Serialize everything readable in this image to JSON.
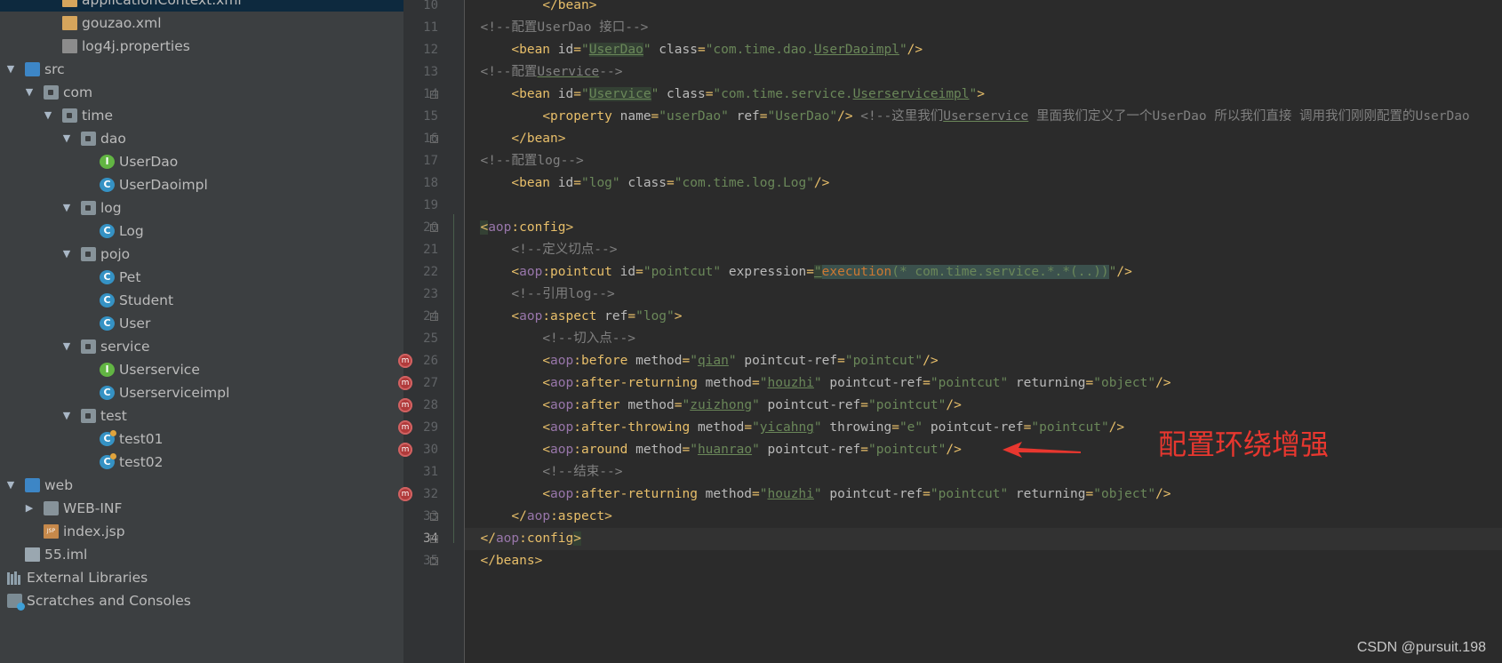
{
  "project_tree": [
    {
      "label": "applicationContext.xml",
      "icon": "xml-file-icon",
      "indent": 2,
      "selected": true
    },
    {
      "label": "gouzao.xml",
      "icon": "xml-file-icon",
      "indent": 2
    },
    {
      "label": "log4j.properties",
      "icon": "properties-file-icon",
      "indent": 2
    },
    {
      "label": "src",
      "icon": "source-folder-icon",
      "indent": 0,
      "expanded": true
    },
    {
      "label": "com",
      "icon": "package-icon",
      "indent": 1,
      "expanded": true
    },
    {
      "label": "time",
      "icon": "package-icon",
      "indent": 2,
      "expanded": true
    },
    {
      "label": "dao",
      "icon": "package-icon",
      "indent": 3,
      "expanded": true
    },
    {
      "label": "UserDao",
      "icon": "interface-icon",
      "indent": 4
    },
    {
      "label": "UserDaoimpl",
      "icon": "class-icon",
      "indent": 4
    },
    {
      "label": "log",
      "icon": "package-icon",
      "indent": 3,
      "expanded": true
    },
    {
      "label": "Log",
      "icon": "class-icon",
      "indent": 4
    },
    {
      "label": "pojo",
      "icon": "package-icon",
      "indent": 3,
      "expanded": true
    },
    {
      "label": "Pet",
      "icon": "class-icon",
      "indent": 4
    },
    {
      "label": "Student",
      "icon": "class-icon",
      "indent": 4
    },
    {
      "label": "User",
      "icon": "class-icon",
      "indent": 4
    },
    {
      "label": "service",
      "icon": "package-icon",
      "indent": 3,
      "expanded": true
    },
    {
      "label": "Userservice",
      "icon": "interface-icon",
      "indent": 4
    },
    {
      "label": "Userserviceimpl",
      "icon": "class-icon",
      "indent": 4
    },
    {
      "label": "test",
      "icon": "package-icon",
      "indent": 3,
      "expanded": true
    },
    {
      "label": "test01",
      "icon": "test-class-icon",
      "indent": 4
    },
    {
      "label": "test02",
      "icon": "test-class-icon",
      "indent": 4
    },
    {
      "label": "web",
      "icon": "web-folder-icon",
      "indent": 0,
      "expanded": true
    },
    {
      "label": "WEB-INF",
      "icon": "folder-icon",
      "indent": 1,
      "expanded": false
    },
    {
      "label": "index.jsp",
      "icon": "jsp-file-icon",
      "indent": 1
    },
    {
      "label": "55.iml",
      "icon": "module-file-icon",
      "indent": 0
    },
    {
      "label": "External Libraries",
      "icon": "libraries-icon",
      "indent": -1
    },
    {
      "label": "Scratches and Consoles",
      "icon": "scratches-icon",
      "indent": -1
    }
  ],
  "editor": {
    "current_line": 34,
    "lines": [
      {
        "n": 10,
        "tokens": [
          [
            "i",
            "        "
          ],
          [
            "b",
            "</bean>"
          ]
        ]
      },
      {
        "n": 11,
        "tokens": [
          [
            "c",
            "<!--配置UserDao 接口-->"
          ]
        ]
      },
      {
        "n": 12,
        "tokens": [
          [
            "i",
            "    "
          ],
          [
            "b",
            "<bean "
          ],
          [
            "a",
            "id"
          ],
          [
            "b",
            "="
          ],
          [
            "s",
            "\""
          ],
          [
            "shl",
            "UserDao"
          ],
          [
            "s",
            "\""
          ],
          [
            "a",
            " class"
          ],
          [
            "b",
            "="
          ],
          [
            "s",
            "\"com.time.dao."
          ],
          [
            "su",
            "UserDaoimpl"
          ],
          [
            "s",
            "\""
          ],
          [
            "b",
            "/>"
          ]
        ]
      },
      {
        "n": 13,
        "tokens": [
          [
            "c",
            "<!--配置"
          ],
          [
            "cu",
            "Uservice"
          ],
          [
            "c",
            "-->"
          ]
        ]
      },
      {
        "n": 14,
        "tokens": [
          [
            "i",
            "    "
          ],
          [
            "b",
            "<bean "
          ],
          [
            "a",
            "id"
          ],
          [
            "b",
            "="
          ],
          [
            "s",
            "\""
          ],
          [
            "shl",
            "Uservice"
          ],
          [
            "s",
            "\""
          ],
          [
            "a",
            " class"
          ],
          [
            "b",
            "="
          ],
          [
            "s",
            "\"com.time.service."
          ],
          [
            "su",
            "Userserviceimpl"
          ],
          [
            "s",
            "\""
          ],
          [
            "b",
            ">"
          ]
        ]
      },
      {
        "n": 15,
        "tokens": [
          [
            "i",
            "        "
          ],
          [
            "b",
            "<property "
          ],
          [
            "a",
            "name"
          ],
          [
            "b",
            "="
          ],
          [
            "s",
            "\"userDao\""
          ],
          [
            "a",
            " ref"
          ],
          [
            "b",
            "="
          ],
          [
            "s",
            "\"UserDao\""
          ],
          [
            "b",
            "/> "
          ],
          [
            "c",
            "<!--这里我们"
          ],
          [
            "cu",
            "Userservice"
          ],
          [
            "c",
            " 里面我们定义了一个UserDao 所以我们直接 调用我们刚刚配置的UserDao"
          ]
        ]
      },
      {
        "n": 16,
        "tokens": [
          [
            "i",
            "    "
          ],
          [
            "b",
            "</bean>"
          ]
        ]
      },
      {
        "n": 17,
        "tokens": [
          [
            "c",
            "<!--配置log-->"
          ]
        ]
      },
      {
        "n": 18,
        "tokens": [
          [
            "i",
            "    "
          ],
          [
            "b",
            "<bean "
          ],
          [
            "a",
            "id"
          ],
          [
            "b",
            "="
          ],
          [
            "s",
            "\"log\""
          ],
          [
            "a",
            " class"
          ],
          [
            "b",
            "="
          ],
          [
            "s",
            "\"com.time.log.Log\""
          ],
          [
            "b",
            "/>"
          ]
        ]
      },
      {
        "n": 19,
        "tokens": []
      },
      {
        "n": 20,
        "tokens": [
          [
            "bhl",
            "<"
          ],
          [
            "ns",
            "aop"
          ],
          [
            "b",
            ":config>"
          ]
        ]
      },
      {
        "n": 21,
        "tokens": [
          [
            "i",
            "    "
          ],
          [
            "c",
            "<!--定义切点-->"
          ]
        ]
      },
      {
        "n": 22,
        "tokens": [
          [
            "i",
            "    "
          ],
          [
            "b",
            "<"
          ],
          [
            "ns",
            "aop"
          ],
          [
            "b",
            ":pointcut "
          ],
          [
            "a",
            "id"
          ],
          [
            "b",
            "="
          ],
          [
            "s",
            "\"pointcut\""
          ],
          [
            "a",
            " expression"
          ],
          [
            "b",
            "="
          ],
          [
            "shl",
            "\""
          ],
          [
            "ohl",
            "execution"
          ],
          [
            "thl",
            "(* com.time.service.*.*(..))"
          ],
          [
            "s",
            "\""
          ],
          [
            "b",
            "/>"
          ]
        ]
      },
      {
        "n": 23,
        "tokens": [
          [
            "i",
            "    "
          ],
          [
            "c",
            "<!--引用log-->"
          ]
        ]
      },
      {
        "n": 24,
        "tokens": [
          [
            "i",
            "    "
          ],
          [
            "b",
            "<"
          ],
          [
            "ns",
            "aop"
          ],
          [
            "b",
            ":aspect "
          ],
          [
            "a",
            "ref"
          ],
          [
            "b",
            "="
          ],
          [
            "s",
            "\"log\""
          ],
          [
            "b",
            ">"
          ]
        ]
      },
      {
        "n": 25,
        "tokens": [
          [
            "i",
            "        "
          ],
          [
            "c",
            "<!--切入点-->"
          ]
        ]
      },
      {
        "n": 26,
        "tokens": [
          [
            "i",
            "        "
          ],
          [
            "b",
            "<"
          ],
          [
            "ns",
            "aop"
          ],
          [
            "b",
            ":before "
          ],
          [
            "a",
            "method"
          ],
          [
            "b",
            "="
          ],
          [
            "s",
            "\""
          ],
          [
            "su",
            "qian"
          ],
          [
            "s",
            "\""
          ],
          [
            "a",
            " pointcut-ref"
          ],
          [
            "b",
            "="
          ],
          [
            "s",
            "\"pointcut\""
          ],
          [
            "b",
            "/>"
          ]
        ]
      },
      {
        "n": 27,
        "tokens": [
          [
            "i",
            "        "
          ],
          [
            "b",
            "<"
          ],
          [
            "ns",
            "aop"
          ],
          [
            "b",
            ":after-returning "
          ],
          [
            "a",
            "method"
          ],
          [
            "b",
            "="
          ],
          [
            "s",
            "\""
          ],
          [
            "su",
            "houzhi"
          ],
          [
            "s",
            "\""
          ],
          [
            "a",
            " pointcut-ref"
          ],
          [
            "b",
            "="
          ],
          [
            "s",
            "\"pointcut\""
          ],
          [
            "a",
            " returning"
          ],
          [
            "b",
            "="
          ],
          [
            "s",
            "\"object\""
          ],
          [
            "b",
            "/>"
          ]
        ]
      },
      {
        "n": 28,
        "tokens": [
          [
            "i",
            "        "
          ],
          [
            "b",
            "<"
          ],
          [
            "ns",
            "aop"
          ],
          [
            "b",
            ":after "
          ],
          [
            "a",
            "method"
          ],
          [
            "b",
            "="
          ],
          [
            "s",
            "\""
          ],
          [
            "su",
            "zuizhong"
          ],
          [
            "s",
            "\""
          ],
          [
            "a",
            " pointcut-ref"
          ],
          [
            "b",
            "="
          ],
          [
            "s",
            "\"pointcut\""
          ],
          [
            "b",
            "/>"
          ]
        ]
      },
      {
        "n": 29,
        "tokens": [
          [
            "i",
            "        "
          ],
          [
            "b",
            "<"
          ],
          [
            "ns",
            "aop"
          ],
          [
            "b",
            ":after-throwing "
          ],
          [
            "a",
            "method"
          ],
          [
            "b",
            "="
          ],
          [
            "s",
            "\""
          ],
          [
            "su",
            "yicahng"
          ],
          [
            "s",
            "\""
          ],
          [
            "a",
            " throwing"
          ],
          [
            "b",
            "="
          ],
          [
            "s",
            "\"e\""
          ],
          [
            "a",
            " pointcut-ref"
          ],
          [
            "b",
            "="
          ],
          [
            "s",
            "\"pointcut\""
          ],
          [
            "b",
            "/>"
          ]
        ]
      },
      {
        "n": 30,
        "tokens": [
          [
            "i",
            "        "
          ],
          [
            "b",
            "<"
          ],
          [
            "ns",
            "aop"
          ],
          [
            "b",
            ":around "
          ],
          [
            "a",
            "method"
          ],
          [
            "b",
            "="
          ],
          [
            "s",
            "\""
          ],
          [
            "su",
            "huanrao"
          ],
          [
            "s",
            "\""
          ],
          [
            "a",
            " pointcut-ref"
          ],
          [
            "b",
            "="
          ],
          [
            "s",
            "\"pointcut\""
          ],
          [
            "b",
            "/>"
          ]
        ]
      },
      {
        "n": 31,
        "tokens": [
          [
            "i",
            "        "
          ],
          [
            "c",
            "<!--结束-->"
          ]
        ]
      },
      {
        "n": 32,
        "tokens": [
          [
            "i",
            "        "
          ],
          [
            "b",
            "<"
          ],
          [
            "ns",
            "aop"
          ],
          [
            "b",
            ":after-returning "
          ],
          [
            "a",
            "method"
          ],
          [
            "b",
            "="
          ],
          [
            "s",
            "\""
          ],
          [
            "su",
            "houzhi"
          ],
          [
            "s",
            "\""
          ],
          [
            "a",
            " pointcut-ref"
          ],
          [
            "b",
            "="
          ],
          [
            "s",
            "\"pointcut\""
          ],
          [
            "a",
            " returning"
          ],
          [
            "b",
            "="
          ],
          [
            "s",
            "\"object\""
          ],
          [
            "b",
            "/>"
          ]
        ]
      },
      {
        "n": 33,
        "tokens": [
          [
            "i",
            "    "
          ],
          [
            "b",
            "</"
          ],
          [
            "ns",
            "aop"
          ],
          [
            "b",
            ":aspect>"
          ]
        ]
      },
      {
        "n": 34,
        "tokens": [
          [
            "b",
            "</"
          ],
          [
            "ns",
            "aop"
          ],
          [
            "b",
            ":config"
          ],
          [
            "bhl",
            ">"
          ]
        ]
      },
      {
        "n": 35,
        "tokens": [
          [
            "b",
            "</beans>"
          ]
        ]
      }
    ],
    "fold_markers": [
      14,
      16,
      20,
      24,
      33,
      34,
      35
    ],
    "breakpoint_lines": [
      26,
      27,
      28,
      29,
      30,
      32
    ],
    "breakpoint_glyph": "m"
  },
  "annotation": {
    "text": "配置环绕增强",
    "color": "#e8372f"
  },
  "watermark": "CSDN @pursuit.198",
  "colors": {
    "tag": "#e8bf6a",
    "attribute": "#bababa",
    "string": "#6a8759",
    "comment": "#808080",
    "namespace": "#9876aa",
    "background": "#2b2b2b",
    "sidebar": "#3c3f41"
  }
}
